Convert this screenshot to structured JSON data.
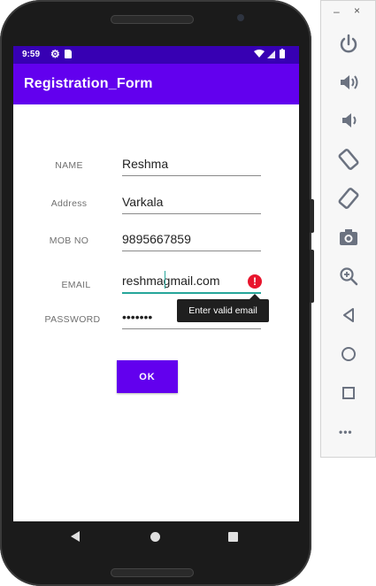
{
  "status_bar": {
    "time": "9:59"
  },
  "app_bar": {
    "title": "Registration_Form"
  },
  "form": {
    "name_label": "NAME",
    "name_value": "Reshma",
    "address_label": "Address",
    "address_value": "Varkala",
    "mob_label": "MOB NO",
    "mob_value": "9895667859",
    "email_label": "EMAIL",
    "email_value": "reshmagmail.com",
    "password_label": "PASSWORD",
    "password_value": "•••••••",
    "error_text": "Enter valid email",
    "error_icon_glyph": "!",
    "ok_label": "OK"
  },
  "colors": {
    "primary": "#6200ee",
    "primary_dark": "#3700b3",
    "accent": "#26a69a",
    "error": "#e8152d"
  },
  "icons": [
    "gear-icon",
    "sd-card-icon",
    "wifi-icon",
    "signal-icon",
    "battery-icon",
    "power-icon",
    "volume-up-icon",
    "volume-down-icon",
    "rotate-left-icon",
    "rotate-right-icon",
    "camera-icon",
    "zoom-icon",
    "back-icon",
    "home-icon",
    "overview-icon",
    "more-icon"
  ],
  "emulator_panel": {
    "minimize": "–",
    "close": "×",
    "more": "•••"
  }
}
